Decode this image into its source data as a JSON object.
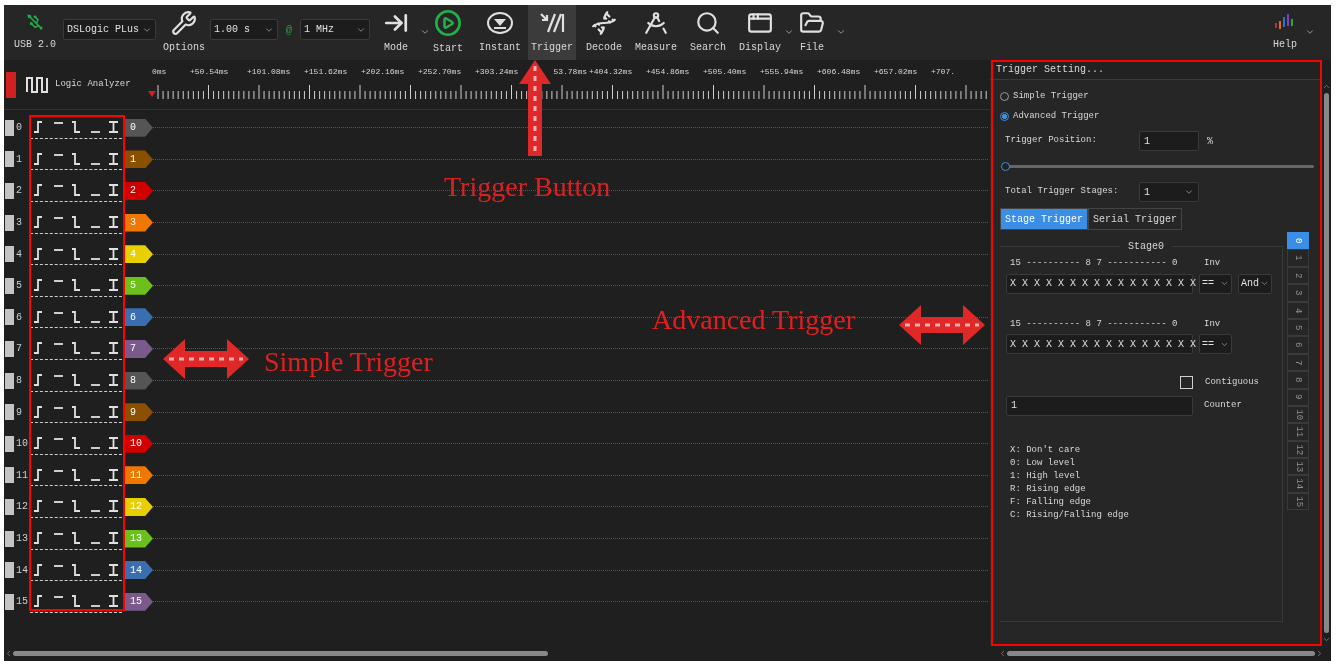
{
  "toolbar": {
    "usb_label": "USB 2.0",
    "device": "DSLogic PLus",
    "options": "Options",
    "duration": "1.00 s",
    "at": "@",
    "rate": "1 MHz",
    "buttons": [
      {
        "label": "Mode",
        "kind": "mode",
        "selected": false,
        "has_menu": true
      },
      {
        "label": "Start",
        "kind": "start",
        "selected": false,
        "has_menu": false
      },
      {
        "label": "Instant",
        "kind": "instant",
        "selected": false,
        "has_menu": false
      },
      {
        "label": "Trigger",
        "kind": "trigger",
        "selected": true,
        "has_menu": false
      },
      {
        "label": "Decode",
        "kind": "decode",
        "selected": false,
        "has_menu": false
      },
      {
        "label": "Measure",
        "kind": "measure",
        "selected": false,
        "has_menu": false
      },
      {
        "label": "Search",
        "kind": "search",
        "selected": false,
        "has_menu": false
      },
      {
        "label": "Display",
        "kind": "display",
        "selected": false,
        "has_menu": true
      },
      {
        "label": "File",
        "kind": "file",
        "selected": false,
        "has_menu": true
      }
    ],
    "help": {
      "label": "Help",
      "has_menu": true
    }
  },
  "ruler": {
    "mode_label": "Logic Analyzer",
    "ticks": [
      "0ms",
      "+50.54ms",
      "+101.08ms",
      "+151.62ms",
      "+202.16ms",
      "+252.70ms",
      "+303.24ms",
      "53.78ms",
      "+404.32ms",
      "+454.86ms",
      "+505.40ms",
      "+555.94ms",
      "+606.48ms",
      "+657.02ms",
      "+707."
    ]
  },
  "channels": [
    {
      "number": "0",
      "tag": "0",
      "color": "#555555"
    },
    {
      "number": "1",
      "tag": "1",
      "color": "#8a5000"
    },
    {
      "number": "2",
      "tag": "2",
      "color": "#d00000"
    },
    {
      "number": "3",
      "tag": "3",
      "color": "#f07800"
    },
    {
      "number": "4",
      "tag": "4",
      "color": "#e8d000"
    },
    {
      "number": "5",
      "tag": "5",
      "color": "#6cc01c"
    },
    {
      "number": "6",
      "tag": "6",
      "color": "#3a6eb0"
    },
    {
      "number": "7",
      "tag": "7",
      "color": "#7a5a8a"
    },
    {
      "number": "8",
      "tag": "8",
      "color": "#555555"
    },
    {
      "number": "9",
      "tag": "9",
      "color": "#8a5000"
    },
    {
      "number": "10",
      "tag": "10",
      "color": "#d00000"
    },
    {
      "number": "11",
      "tag": "11",
      "color": "#f07800"
    },
    {
      "number": "12",
      "tag": "12",
      "color": "#e8d000"
    },
    {
      "number": "13",
      "tag": "13",
      "color": "#6cc01c"
    },
    {
      "number": "14",
      "tag": "14",
      "color": "#3a6eb0"
    },
    {
      "number": "15",
      "tag": "15",
      "color": "#7a5a8a"
    }
  ],
  "trigger_panel": {
    "title": "Trigger Setting...",
    "modes": [
      {
        "label": "Simple Trigger",
        "selected": false
      },
      {
        "label": "Advanced Trigger",
        "selected": true
      }
    ],
    "position_label": "Trigger Position:",
    "position_value": "1",
    "position_unit": "%",
    "position_slider": {
      "level": 0.01
    },
    "stages_label": "Total Trigger Stages:",
    "stages_value": "1",
    "tabs": [
      {
        "label": "Stage Trigger",
        "selected": true
      },
      {
        "label": "Serial Trigger",
        "selected": false
      }
    ],
    "stage_title": "Stage0",
    "conditions": [
      {
        "bits_header": "15 ---------- 8 7 ----------- 0",
        "inv_label": "Inv",
        "value": "X X X X X X X X X X X X X X X X",
        "compare": "==",
        "logic": "And"
      },
      {
        "bits_header": "15 ---------- 8 7 ----------- 0",
        "inv_label": "Inv",
        "value": "X X X X X X X X X X X X X X X X",
        "compare": "=="
      }
    ],
    "contiguous": {
      "label": "Contiguous",
      "checked": false
    },
    "counter": {
      "value": "1",
      "label": "Counter"
    },
    "legend": [
      "X: Don't care",
      "0: Low level",
      "1: High level",
      "R: Rising edge",
      "F: Falling edge",
      "C: Rising/Falling edge"
    ],
    "stage_tabs": [
      {
        "label": "0",
        "selected": true
      },
      {
        "label": "1",
        "selected": false
      },
      {
        "label": "2",
        "selected": false
      },
      {
        "label": "3",
        "selected": false
      },
      {
        "label": "4",
        "selected": false
      },
      {
        "label": "5",
        "selected": false
      },
      {
        "label": "6",
        "selected": false
      },
      {
        "label": "7",
        "selected": false
      },
      {
        "label": "8",
        "selected": false
      },
      {
        "label": "9",
        "selected": false
      },
      {
        "label": "10",
        "selected": false
      },
      {
        "label": "11",
        "selected": false
      },
      {
        "label": "12",
        "selected": false
      },
      {
        "label": "13",
        "selected": false
      },
      {
        "label": "14",
        "selected": false
      },
      {
        "label": "15",
        "selected": false
      }
    ]
  },
  "annotations": [
    {
      "text": "Trigger Button",
      "kind": "up"
    },
    {
      "text": "Advanced Trigger",
      "kind": "both"
    },
    {
      "text": "Simple Trigger",
      "kind": "both"
    }
  ]
}
